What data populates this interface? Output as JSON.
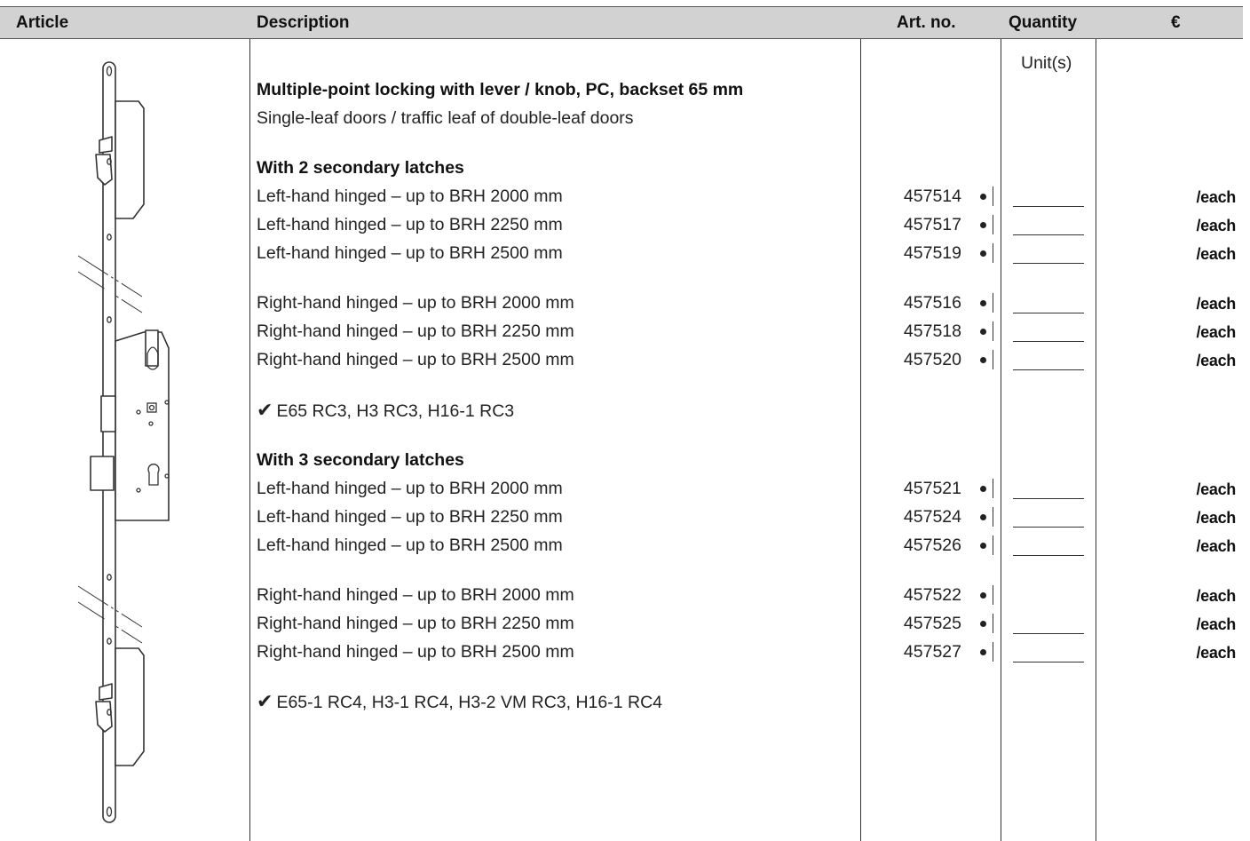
{
  "header": {
    "article": "Article",
    "description": "Description",
    "art_no": "Art. no.",
    "quantity": "Quantity",
    "price": "€"
  },
  "unit_label": "Unit(s)",
  "product": {
    "title": "Multiple-point locking with lever / knob, PC, backset 65 mm",
    "subtitle": "Single-leaf doors / traffic leaf of double-leaf doors"
  },
  "groups": [
    {
      "heading": "With 2 secondary latches",
      "rows": [
        {
          "desc": "Left-hand hinged – up to BRH 2000 mm",
          "art": "457514",
          "price": "/each"
        },
        {
          "desc": "Left-hand hinged – up to BRH 2250 mm",
          "art": "457517",
          "price": "/each"
        },
        {
          "desc": "Left-hand hinged – up to BRH 2500 mm",
          "art": "457519",
          "price": "/each"
        },
        {
          "desc": "Right-hand hinged – up to BRH 2000 mm",
          "art": "457516",
          "price": "/each"
        },
        {
          "desc": "Right-hand hinged – up to BRH 2250 mm",
          "art": "457518",
          "price": "/each"
        },
        {
          "desc": "Right-hand hinged – up to BRH 2500 mm",
          "art": "457520",
          "price": "/each"
        }
      ],
      "compat": "E65 RC3, H3 RC3, H16-1 RC3"
    },
    {
      "heading": "With 3 secondary latches",
      "rows": [
        {
          "desc": "Left-hand hinged – up to BRH 2000 mm",
          "art": "457521",
          "price": "/each"
        },
        {
          "desc": "Left-hand hinged – up to BRH 2250 mm",
          "art": "457524",
          "price": "/each"
        },
        {
          "desc": "Left-hand hinged – up to BRH 2500 mm",
          "art": "457526",
          "price": "/each"
        },
        {
          "desc": "Right-hand hinged – up to BRH 2000 mm",
          "art": "457522",
          "price": "/each"
        },
        {
          "desc": "Right-hand hinged – up to BRH 2250 mm",
          "art": "457525",
          "price": "/each"
        },
        {
          "desc": "Right-hand hinged – up to BRH 2500 mm",
          "art": "457527",
          "price": "/each"
        }
      ],
      "compat": "E65-1 RC4, H3-1 RC4, H3-2 VM RC3, H16-1 RC4"
    }
  ],
  "check_glyph": "✔",
  "icons": {
    "article_image": "multipoint-lock-drawing-icon",
    "bullet": "bullet-dot-icon",
    "check": "check-mark-icon"
  }
}
